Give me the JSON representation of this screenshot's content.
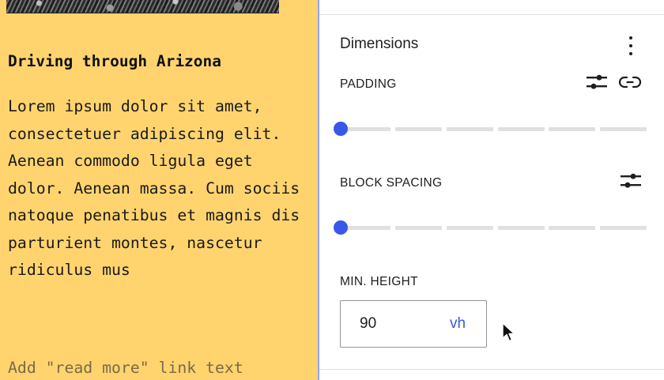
{
  "canvas": {
    "post_title": "Driving through Arizona",
    "excerpt": "Lorem ipsum dolor sit amet, consectetuer adipiscing elit. Aenean commodo ligula eget dolor. Aenean massa. Cum sociis natoque penatibus et magnis dis parturient montes, nascetur ridiculus mus",
    "read_more_placeholder": "Add \"read more\" link text"
  },
  "dimensions_panel": {
    "title": "Dimensions",
    "more_icon": "more-vertical-icon",
    "padding": {
      "label": "PADDING",
      "icons": [
        "sliders-icon",
        "unlink-icon"
      ],
      "value_fraction": 0
    },
    "block_spacing": {
      "label": "BLOCK SPACING",
      "icons": [
        "sliders-icon"
      ],
      "value_fraction": 0
    },
    "min_height": {
      "label": "MIN. HEIGHT",
      "value": "90",
      "unit": "vh"
    }
  },
  "colors": {
    "canvas_background": "#ffd46f",
    "accent": "#3858e9",
    "track": "#e0e0e0",
    "text": "#1e1e1e"
  }
}
